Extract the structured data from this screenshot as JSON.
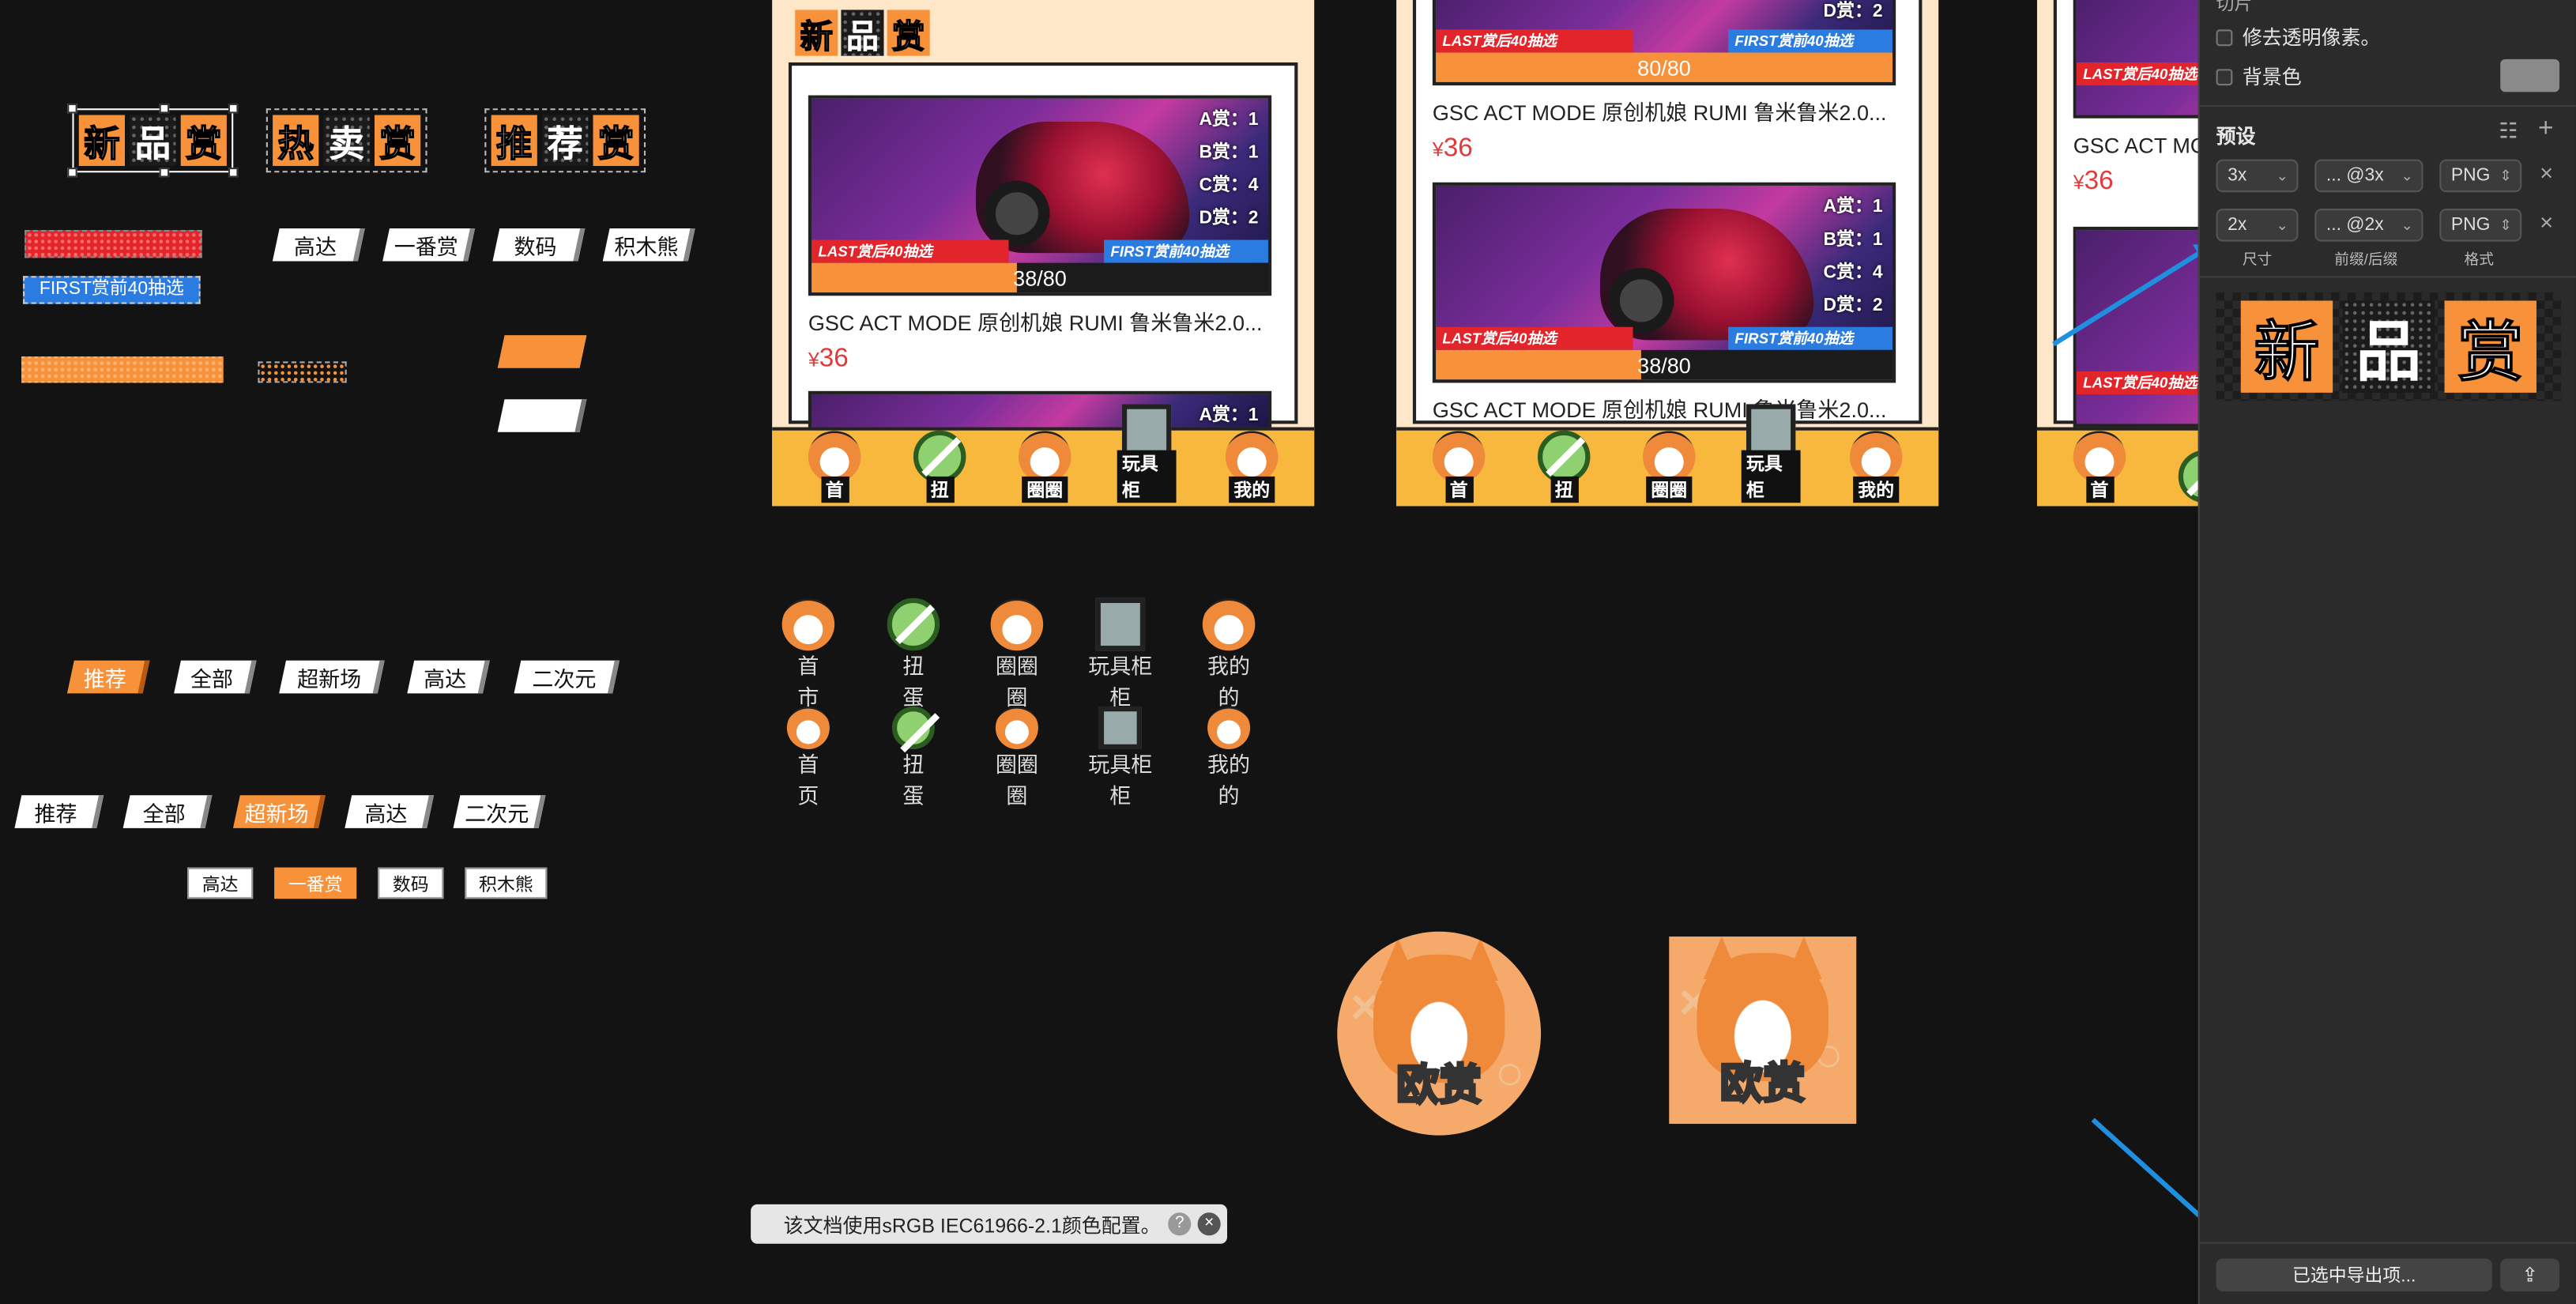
{
  "title_tags": {
    "new": [
      "新",
      "品",
      "赏"
    ],
    "hot": [
      "热",
      "卖",
      "赏"
    ],
    "rec": [
      "推",
      "荐",
      "赏"
    ]
  },
  "category_tags_row1": [
    "高达",
    "一番赏",
    "数码",
    "积木熊"
  ],
  "first_badge": "FIRST赏前40抽选",
  "filter_tags_row1": [
    "推荐",
    "全部",
    "超新场",
    "高达",
    "二次元"
  ],
  "filter_tags_row2": [
    "推荐",
    "全部",
    "超新场",
    "高达",
    "二次元"
  ],
  "box_tags": [
    "高达",
    "一番赏",
    "数码",
    "积木熊"
  ],
  "phones": {
    "header": [
      "新",
      "品",
      "赏"
    ],
    "card": {
      "title": "GSC ACT MODE 原创机娘 RUMI 鲁米鲁米2.0...",
      "price_symbol": "¥",
      "price": "36",
      "stats": [
        "A赏：1",
        "B赏：1",
        "C赏：4",
        "D赏：2"
      ],
      "last": "LAST赏后40抽选",
      "first": "FIRST赏前40抽选"
    },
    "progress_a": "38/80",
    "progress_b": "80/80",
    "stat_d_top": "D赏：2",
    "stat_a_top": "A赏：1"
  },
  "tabs": [
    "首",
    "扭",
    "圈圈",
    "玩具柜",
    "我的"
  ],
  "icon_grid": {
    "row1": [
      [
        "首",
        "市"
      ],
      [
        "扭",
        "蛋"
      ],
      [
        "圈圈",
        "圈"
      ],
      [
        "玩具柜",
        "柜"
      ],
      [
        "我的",
        "的"
      ]
    ],
    "row2": [
      [
        "首",
        "页"
      ],
      [
        "扭",
        "蛋"
      ],
      [
        "圈圈",
        "圈"
      ],
      [
        "玩具柜",
        "柜"
      ],
      [
        "我的",
        "的"
      ]
    ]
  },
  "avatar_text": "欧赏",
  "toast": {
    "text": "该文档使用sRGB IEC61966-2.1颜色配置。",
    "help": "?",
    "close": "×"
  },
  "panel": {
    "section_top": "切片",
    "trim_label": "修去透明像素。",
    "bg_label": "背景色",
    "preset_title": "预设",
    "rows": [
      {
        "size": "3x",
        "suffix": "... @3x",
        "format": "PNG"
      },
      {
        "size": "2x",
        "suffix": "... @2x",
        "format": "PNG"
      }
    ],
    "col_size": "尺寸",
    "col_suffix": "前缀/后缀",
    "col_format": "格式",
    "preview": [
      "新",
      "品",
      "赏"
    ],
    "export_btn": "已选中导出项...",
    "share_icon": "⇪"
  },
  "colors": {
    "accent_orange": "#f7913a",
    "bg": "#131313",
    "arrow": "#1f8fe0",
    "price_red": "#e23a3a"
  }
}
